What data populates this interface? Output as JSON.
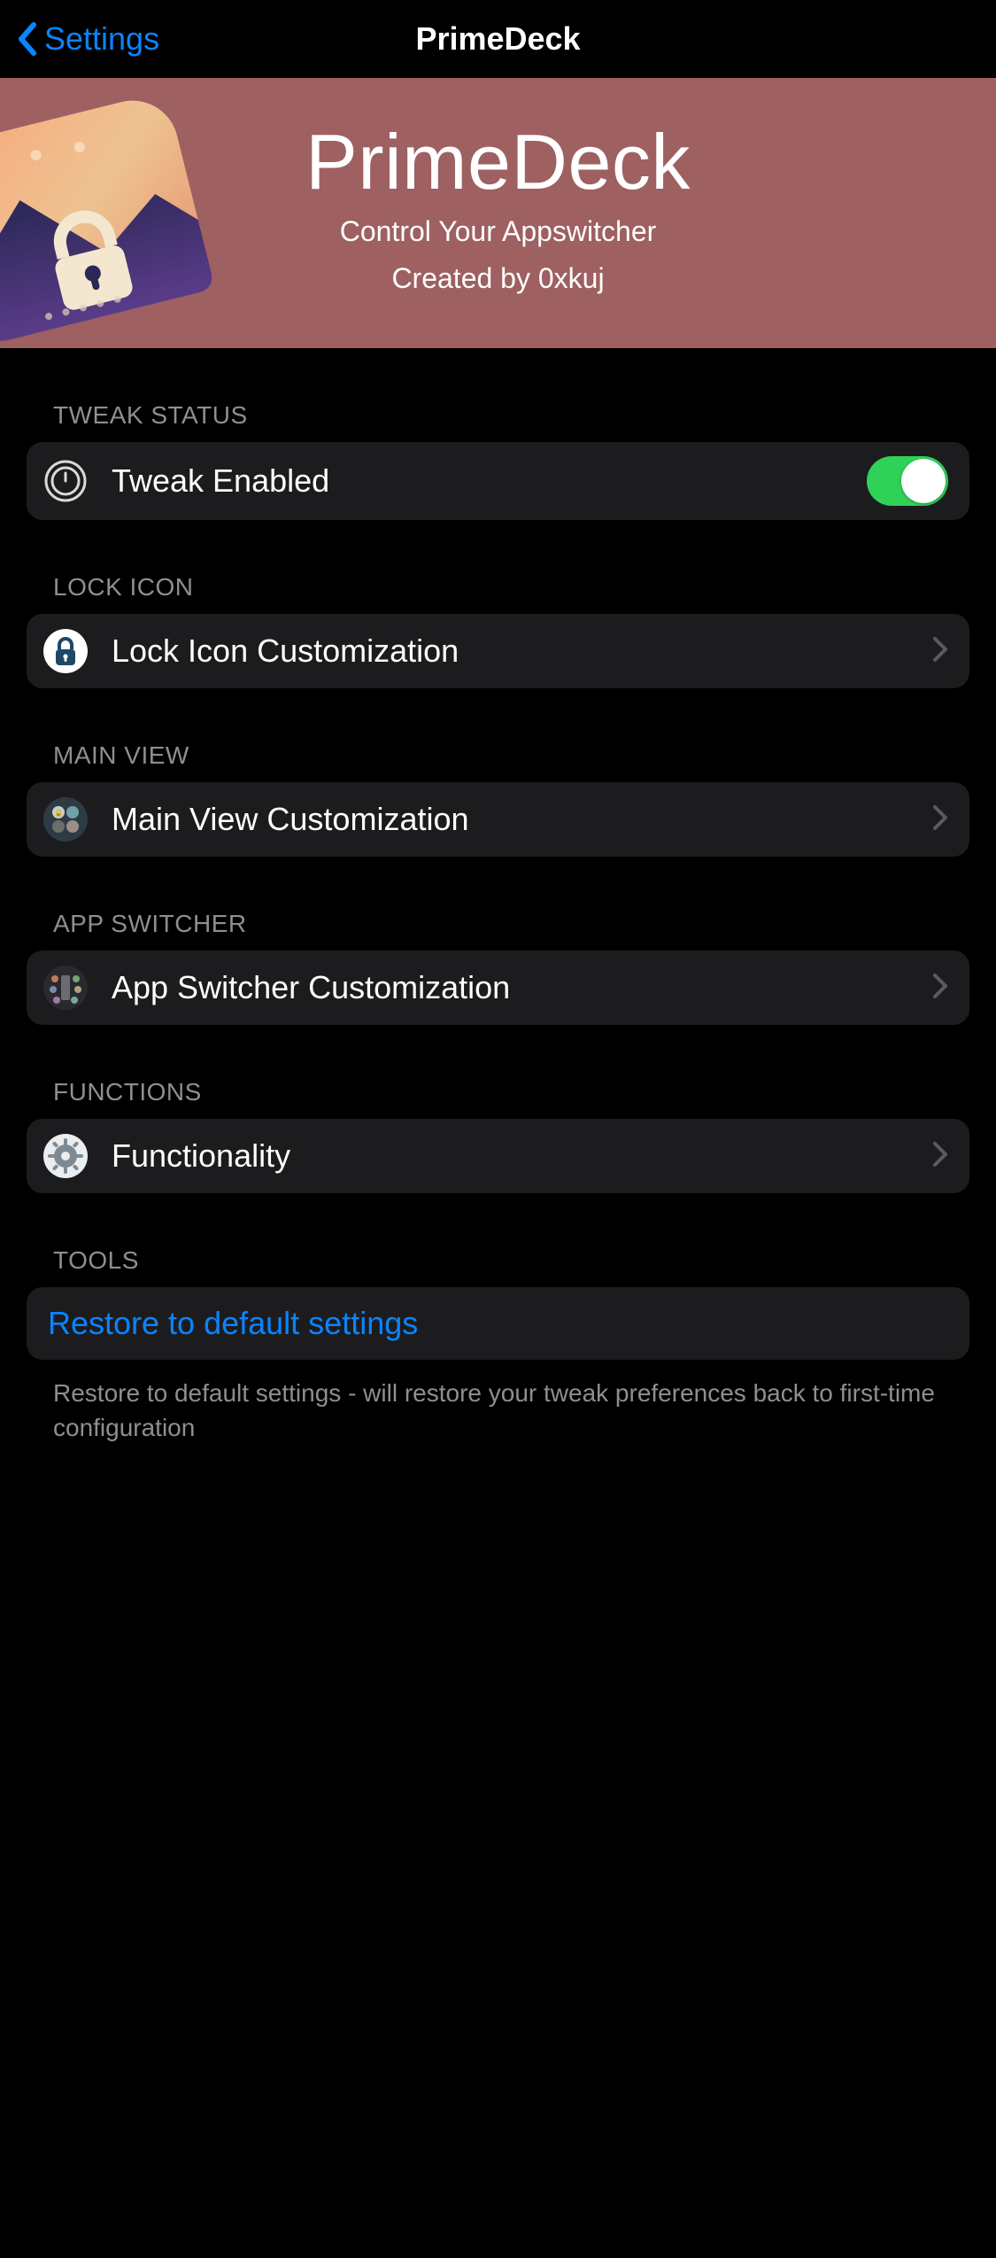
{
  "nav": {
    "back_label": "Settings",
    "title": "PrimeDeck"
  },
  "hero": {
    "title": "PrimeDeck",
    "subtitle": "Control Your Appswitcher",
    "author_line": "Created by 0xkuj"
  },
  "sections": {
    "tweak_status": {
      "header": "Tweak Status",
      "enabled_label": "Tweak Enabled",
      "enabled_value": true
    },
    "lock_icon": {
      "header": "Lock Icon",
      "row_label": "Lock Icon Customization"
    },
    "main_view": {
      "header": "Main View",
      "row_label": "Main View Customization"
    },
    "app_switcher": {
      "header": "App Switcher",
      "row_label": "App Switcher Customization"
    },
    "functions": {
      "header": "Functions",
      "row_label": "Functionality"
    },
    "tools": {
      "header": "Tools",
      "restore_label": "Restore to default settings",
      "restore_footer": "Restore to default settings - will restore your tweak preferences back to first-time configuration"
    }
  },
  "icons": {
    "tweak_power": "power-icon",
    "lock": "lock-icon",
    "main_view": "grid-icon",
    "app_switcher": "apps-icon",
    "gear": "gear-icon"
  },
  "colors": {
    "accent": "#0a84ff",
    "switch_on": "#30d158",
    "hero_bg": "#9e6061",
    "cell_bg": "#1c1c1e"
  }
}
